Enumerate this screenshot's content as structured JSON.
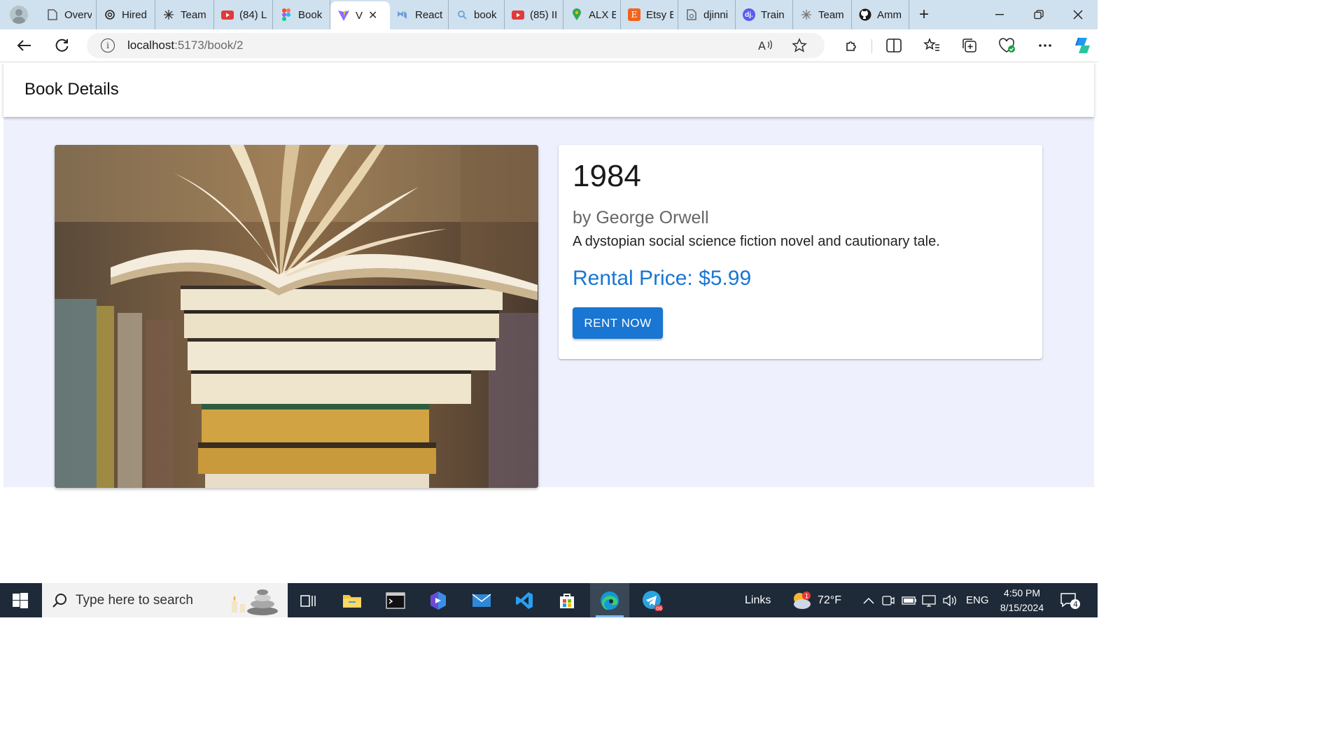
{
  "browser": {
    "tabs": [
      {
        "title": "Overv",
        "icon": "document-icon"
      },
      {
        "title": "Hired",
        "icon": "openai-icon"
      },
      {
        "title": "Team",
        "icon": "sparkle-icon"
      },
      {
        "title": "(84) L",
        "icon": "youtube-icon"
      },
      {
        "title": "Book",
        "icon": "figma-icon"
      },
      {
        "title": "V",
        "icon": "vite-icon",
        "active": true
      },
      {
        "title": "React",
        "icon": "mui-icon"
      },
      {
        "title": "book",
        "icon": "search-icon"
      },
      {
        "title": "(85) II",
        "icon": "youtube-icon"
      },
      {
        "title": "ALX E",
        "icon": "maps-icon"
      },
      {
        "title": "Etsy E",
        "icon": "etsy-icon"
      },
      {
        "title": "djinni",
        "icon": "document-icon"
      },
      {
        "title": "Train",
        "icon": "djinni-icon"
      },
      {
        "title": "Team",
        "icon": "sparkle-icon"
      },
      {
        "title": "Amm",
        "icon": "github-icon"
      }
    ],
    "url_host": "localhost",
    "url_path": ":5173/book/2"
  },
  "app": {
    "header_title": "Book Details"
  },
  "book": {
    "title": "1984",
    "author": "by George Orwell",
    "description": "A dystopian social science fiction novel and cautionary tale.",
    "price": "Rental Price: $5.99",
    "rent_button": "RENT NOW"
  },
  "taskbar": {
    "search_placeholder": "Type here to search",
    "links_label": "Links",
    "weather_temp": "72°F",
    "weather_badge": "1",
    "language": "ENG",
    "time": "4:50 PM",
    "date": "8/15/2024",
    "notification_count": "4",
    "telegram_badge": "06"
  },
  "colors": {
    "accent": "#1976d2",
    "page_bg": "#eef1fd",
    "taskbar_bg": "#1e2a38"
  }
}
